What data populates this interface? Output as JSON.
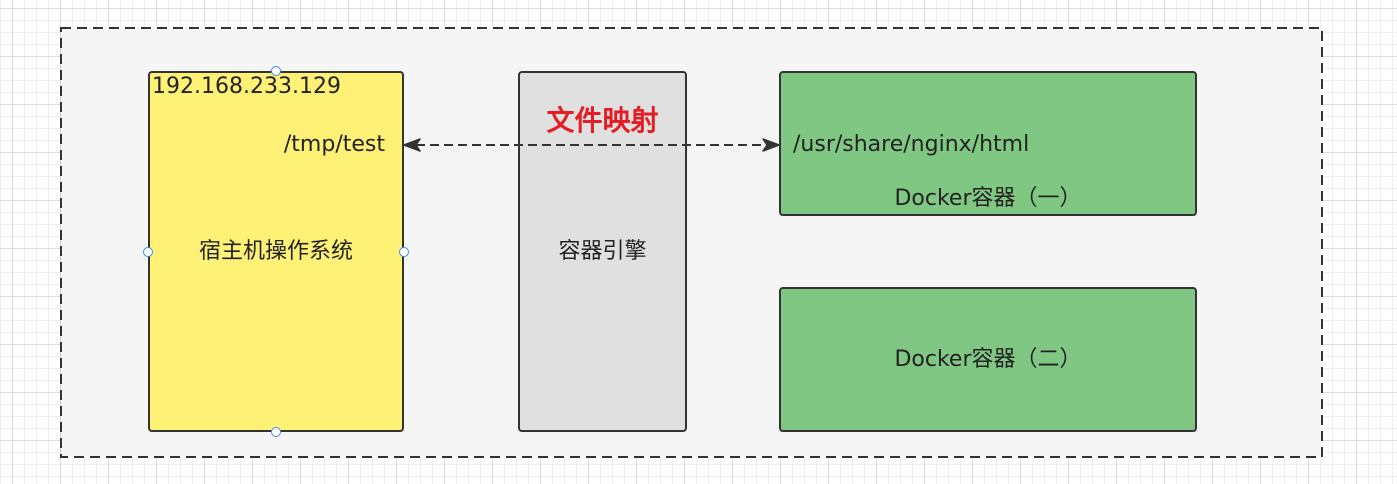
{
  "diagram": {
    "host": {
      "ip": "192.168.233.129",
      "path": "/tmp/test",
      "label": "宿主机操作系统"
    },
    "engine": {
      "label": "容器引擎"
    },
    "mapping": {
      "label": "文件映射"
    },
    "container_one": {
      "path": "/usr/share/nginx/html",
      "label": "Docker容器（一）"
    },
    "container_two": {
      "label": "Docker容器（二）"
    }
  },
  "colors": {
    "host_fill": "#fff176",
    "engine_fill": "#e0e0e0",
    "container_fill": "#81c784",
    "group_fill": "#f5f5f5",
    "stroke": "#333333",
    "mapping_text": "#e51c23",
    "selection_handle": "#3d8bfd"
  }
}
